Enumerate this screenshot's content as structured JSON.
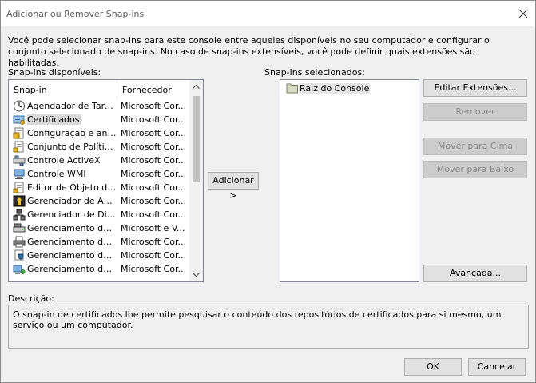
{
  "window": {
    "title": "Adicionar ou Remover Snap-ins"
  },
  "intro": "Você pode selecionar snap-ins para este console entre aqueles disponíveis no seu computador e configurar o conjunto selecionado de snap-ins. No caso de snap-ins extensíveis, você pode definir quais extensões são habilitadas.",
  "available": {
    "label": "Snap-ins disponíveis:",
    "col_name": "Snap-in",
    "col_vendor": "Fornecedor",
    "items": [
      {
        "icon": "clock-icon",
        "name": "Agendador de Tarefas",
        "vendor": "Microsoft Cor..."
      },
      {
        "icon": "certificate-icon",
        "name": "Certificados",
        "vendor": "Microsoft Cor..."
      },
      {
        "icon": "security-config-icon",
        "name": "Configuração e análi...",
        "vendor": "Microsoft Cor..."
      },
      {
        "icon": "policy-document-icon",
        "name": "Conjunto de Política...",
        "vendor": "Microsoft Cor..."
      },
      {
        "icon": "activex-icon",
        "name": "Controle ActiveX",
        "vendor": "Microsoft Cor..."
      },
      {
        "icon": "wmi-computer-icon",
        "name": "Controle WMI",
        "vendor": "Microsoft Cor..."
      },
      {
        "icon": "object-editor-icon",
        "name": "Editor de Objeto de ...",
        "vendor": "Microsoft Cor..."
      },
      {
        "icon": "authorization-icon",
        "name": "Gerenciador de Aut...",
        "vendor": "Microsoft Cor..."
      },
      {
        "icon": "device-manager-icon",
        "name": "Gerenciador de Disp...",
        "vendor": "Microsoft Cor..."
      },
      {
        "icon": "disk-management-icon",
        "name": "Gerenciamento de di...",
        "vendor": "Microsoft e V..."
      },
      {
        "icon": "printer-icon",
        "name": "Gerenciamento de I...",
        "vendor": "Microsoft Cor..."
      },
      {
        "icon": "policy-shield-icon",
        "name": "Gerenciamento de p...",
        "vendor": "Microsoft Cor..."
      },
      {
        "icon": "computer-management-icon",
        "name": "Gerenciamento do c...",
        "vendor": "Microsoft Cor..."
      }
    ]
  },
  "add_button": "Adicionar >",
  "selected": {
    "label": "Snap-ins selecionados:",
    "root": "Raiz do Console"
  },
  "buttons": {
    "edit_extensions": "Editar Extensões...",
    "remove": "Remover",
    "move_up": "Mover para Cima",
    "move_down": "Mover para Baixo",
    "advanced": "Avançada...",
    "ok": "OK",
    "cancel": "Cancelar"
  },
  "description": {
    "label": "Descrição:",
    "text": "O snap-in de certificados lhe permite pesquisar o conteúdo dos repositórios de certificados para si mesmo, um serviço ou um computador."
  }
}
